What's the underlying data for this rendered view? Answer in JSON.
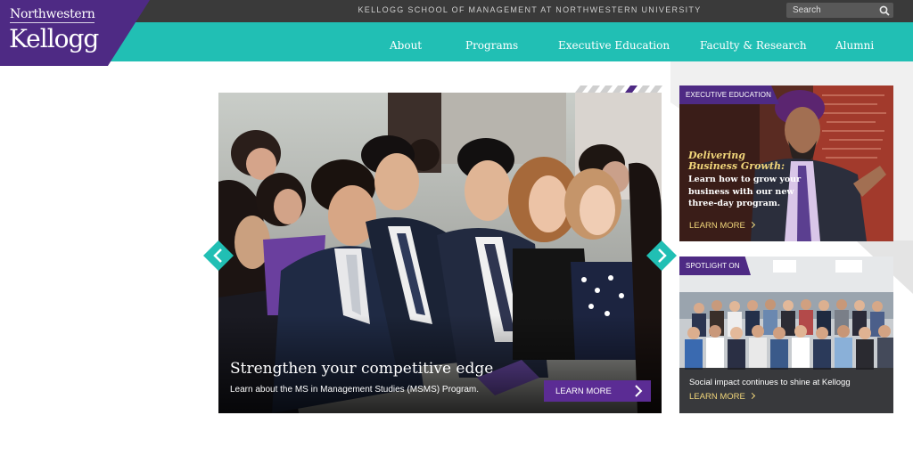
{
  "topbar": {
    "tagline": "KELLOGG SCHOOL OF MANAGEMENT AT NORTHWESTERN UNIVERSITY",
    "search_placeholder": "Search",
    "search_icon": "search-icon"
  },
  "logo": {
    "line1": "Northwestern",
    "line2": "Kellogg"
  },
  "nav": {
    "items": [
      {
        "label": "About"
      },
      {
        "label": "Programs"
      },
      {
        "label": "Executive Education"
      },
      {
        "label": "Faculty & Research"
      },
      {
        "label": "Alumni"
      }
    ]
  },
  "hero": {
    "title": "Strengthen your competitive edge",
    "subtitle": "Learn about the MS in Management Studies (MSMS) Program.",
    "cta_label": "LEARN MORE",
    "prev_icon": "chevron-left-icon",
    "next_icon": "chevron-right-icon"
  },
  "cards": {
    "exec": {
      "tag": "EXECUTIVE EDUCATION",
      "headline_line1": "Delivering",
      "headline_line2": "Business Growth:",
      "body": "Learn how to grow your business with our new three-day program.",
      "more": "LEARN MORE"
    },
    "spotlight": {
      "tag": "SPOTLIGHT ON",
      "caption": "Social impact continues to shine at Kellogg",
      "more": "LEARN MORE"
    }
  },
  "colors": {
    "purple": "#4e2a84",
    "teal": "#21bfb4",
    "gold": "#f0d57a",
    "dark": "#3a3a3a"
  }
}
